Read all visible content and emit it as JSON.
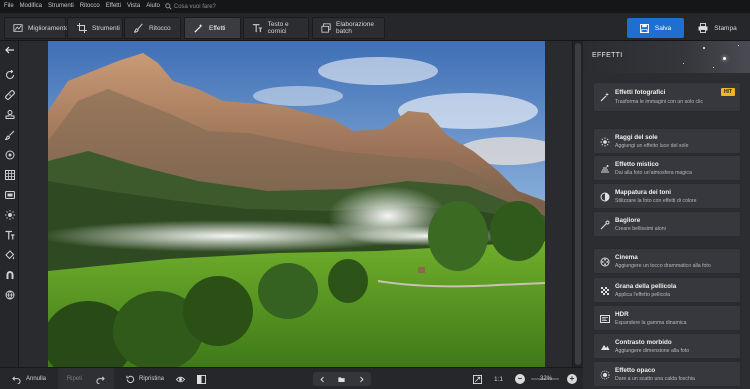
{
  "menu": {
    "items": [
      "File",
      "Modifica",
      "Strumenti",
      "Ritocco",
      "Effetti",
      "Vista",
      "Aiuto"
    ],
    "search_placeholder": "Cosa vuoi fare?"
  },
  "toolbar": {
    "tabs": [
      {
        "label": "Miglioramento",
        "icon": "enhance-icon",
        "active": false
      },
      {
        "label": "Strumenti",
        "icon": "crop-icon",
        "active": false
      },
      {
        "label": "Ritocco",
        "icon": "brush-icon",
        "active": false
      },
      {
        "label": "Effetti",
        "icon": "magic-wand-icon",
        "active": true
      },
      {
        "label": "Testo e cornici",
        "icon": "text-icon",
        "active": false
      },
      {
        "label": "Elaborazione batch",
        "icon": "batch-icon",
        "active": false
      }
    ],
    "save_label": "Salva",
    "print_label": "Stampa",
    "save_color": "#1f6fd0"
  },
  "left_tools": [
    "back-arrow-icon",
    "rotate-icon",
    "bandage-icon",
    "stamp-icon",
    "brush-icon",
    "target-icon",
    "grid-icon",
    "frame-icon",
    "sun-icon",
    "text-icon",
    "fill-icon",
    "magnet-icon",
    "globe-icon"
  ],
  "panel": {
    "title": "EFFETTI",
    "cards": [
      {
        "title": "Effetti fotografici",
        "desc": "Trasforma le immagini con un solo clic",
        "icon": "magic-wand-icon",
        "badge": "HIT"
      },
      {
        "title": "Raggi del sole",
        "desc": "Aggiungi un effetto luce del sole",
        "icon": "sun-rays-icon"
      },
      {
        "title": "Effetto mistico",
        "desc": "Dai alla foto un'atmosfera magica",
        "icon": "mystic-icon"
      },
      {
        "title": "Mappatura dei toni",
        "desc": "Stilizzare la foto con effetti di colore",
        "icon": "tone-map-icon"
      },
      {
        "title": "Bagliore",
        "desc": "Creare bellissimi aloni",
        "icon": "glow-icon"
      },
      {
        "title": "Cinema",
        "desc": "Aggiungere un tocco drammatico alla foto",
        "icon": "film-reel-icon"
      },
      {
        "title": "Grana della pellicola",
        "desc": "Applica l'effetto pellicola",
        "icon": "grain-icon"
      },
      {
        "title": "HDR",
        "desc": "Espandere la gamma dinamica",
        "icon": "hdr-icon"
      },
      {
        "title": "Contrasto morbido",
        "desc": "Aggiungere dimensione alla foto",
        "icon": "contrast-icon"
      },
      {
        "title": "Effetto opaco",
        "desc": "Dare a un scatto una calda foschia",
        "icon": "matte-icon"
      }
    ]
  },
  "bottom": {
    "undo_label": "Annulla",
    "redo_label": "Ripeti",
    "restore_label": "Ripristina",
    "ratio_label": "1:1",
    "zoom_level": "32%"
  }
}
